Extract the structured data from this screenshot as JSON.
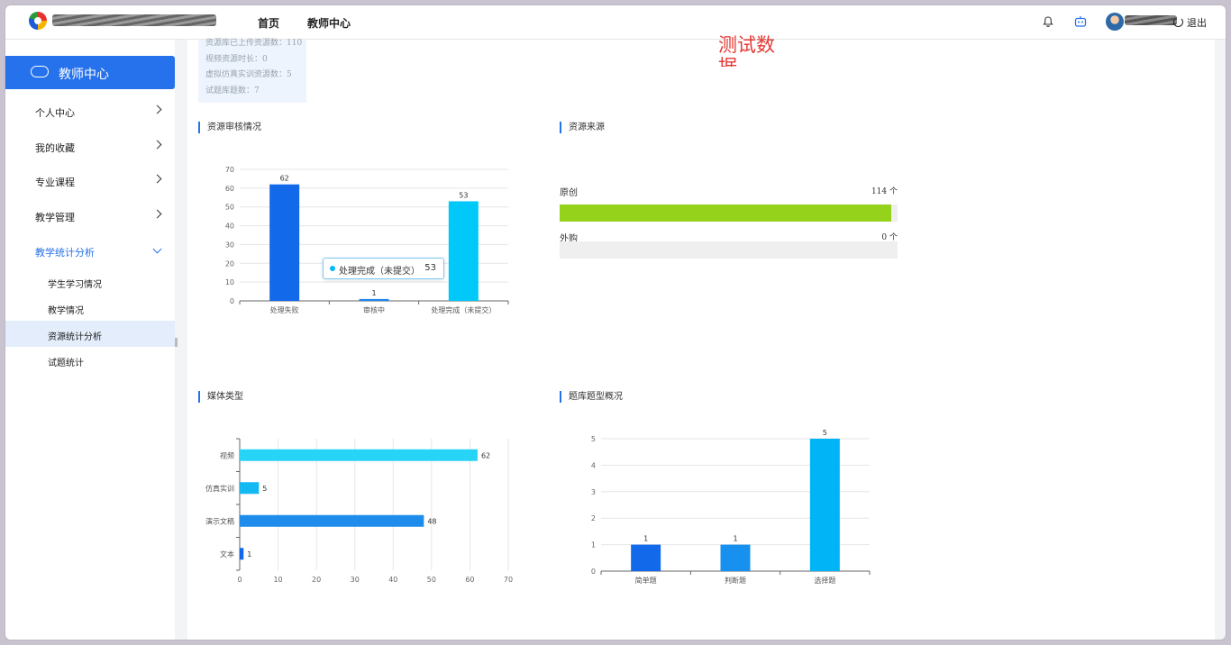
{
  "header": {
    "nav": [
      "首页",
      "教师中心"
    ],
    "logout_label": "退出",
    "icons": [
      "bell-icon",
      "robot-icon",
      "avatar",
      "power-icon"
    ]
  },
  "sidebar": {
    "title": "教师中心",
    "items": [
      {
        "label": "个人中心",
        "expanded": false
      },
      {
        "label": "我的收藏",
        "expanded": false
      },
      {
        "label": "专业课程",
        "expanded": false
      },
      {
        "label": "教学管理",
        "expanded": false
      },
      {
        "label": "教学统计分析",
        "expanded": true
      }
    ],
    "subitems": [
      {
        "label": "学生学习情况",
        "selected": false
      },
      {
        "label": "教学情况",
        "selected": false
      },
      {
        "label": "资源统计分析",
        "selected": true
      },
      {
        "label": "试题统计",
        "selected": false
      }
    ]
  },
  "main": {
    "stats": [
      "资源库已上传资源数：110",
      "视频资源时长：0",
      "虚拟仿真实训资源数：5",
      "试题库题数：7"
    ],
    "watermark": "测试数据",
    "sections": {
      "review": "资源审核情况",
      "source": "资源来源",
      "media": "媒体类型",
      "question": "题库题型概况"
    },
    "tooltip": {
      "label": "处理完成（未提交）",
      "value": "53"
    },
    "source": {
      "rows": [
        {
          "label": "原创",
          "value_text": "114 个",
          "fraction": 0.98
        },
        {
          "label": "外购",
          "value_text": "0 个",
          "fraction": 0
        }
      ]
    }
  },
  "chart_data": [
    {
      "type": "bar",
      "title": "资源审核情况",
      "categories": [
        "处理失败",
        "审核中",
        "处理完成（未提交）"
      ],
      "values": [
        62,
        1,
        53
      ],
      "ylim": [
        0,
        70
      ],
      "yticks": [
        0,
        10,
        20,
        30,
        40,
        50,
        60,
        70
      ],
      "colors": [
        "#1269ea",
        "#1b86ee",
        "#00c8f8"
      ],
      "grid": true
    },
    {
      "type": "bar",
      "orientation": "horizontal",
      "title": "媒体类型",
      "categories": [
        "视频",
        "仿真实训",
        "演示文稿",
        "文本"
      ],
      "values": [
        62,
        5,
        48,
        1
      ],
      "xlim": [
        0,
        70
      ],
      "xticks": [
        0,
        10,
        20,
        30,
        40,
        50,
        60,
        70
      ],
      "colors": [
        "#27d4f5",
        "#14b8f3",
        "#1d8ceb",
        "#1268ea"
      ],
      "grid": true
    },
    {
      "type": "bar",
      "title": "题库题型概况",
      "categories": [
        "简单题",
        "判断题",
        "选择题"
      ],
      "values": [
        1,
        1,
        5
      ],
      "ylim": [
        0,
        5
      ],
      "yticks": [
        0,
        1,
        2,
        3,
        4,
        5
      ],
      "colors": [
        "#1269ea",
        "#1790ef",
        "#00b4f6"
      ],
      "grid": true
    }
  ]
}
